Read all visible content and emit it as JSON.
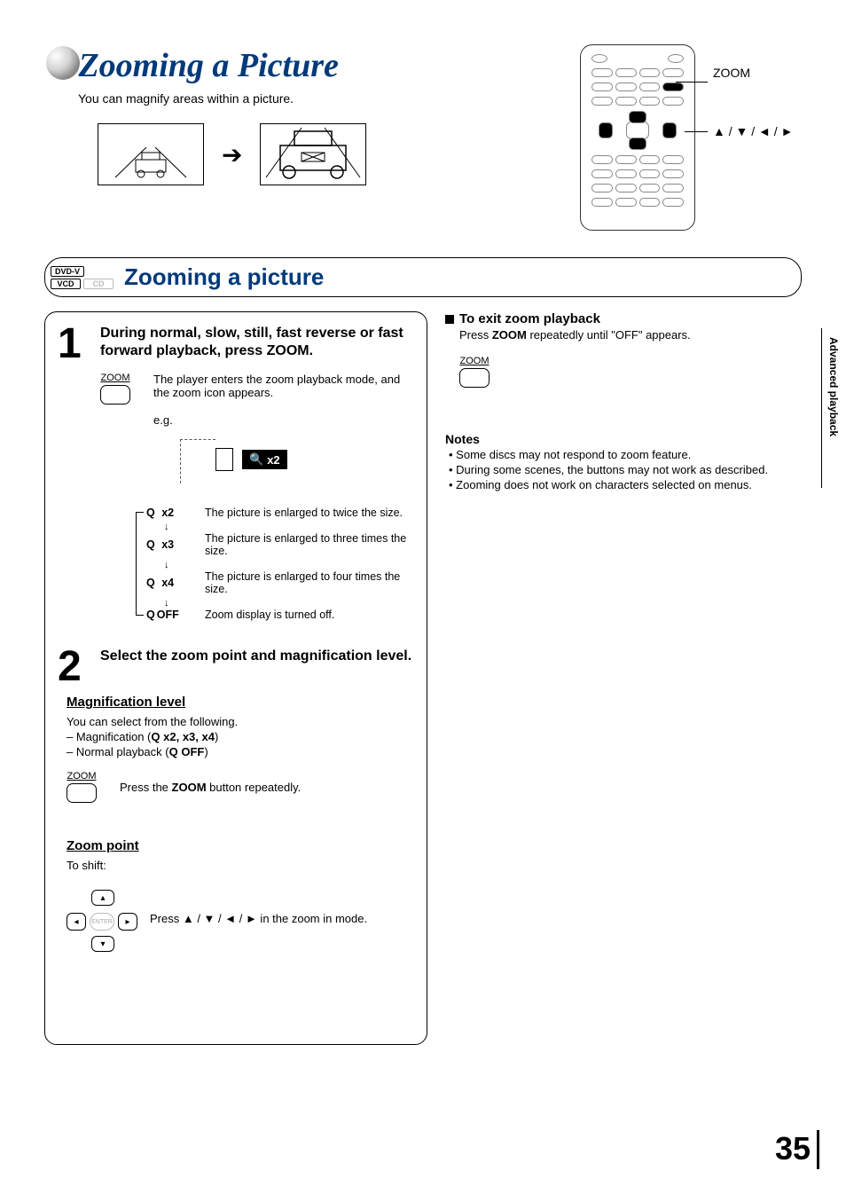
{
  "header": {
    "title": "Zooming a Picture",
    "subtitle": "You can magnify areas within a picture."
  },
  "remote": {
    "label_zoom": "ZOOM",
    "label_dpad": "▲ / ▼ / ◄ / ►"
  },
  "section": {
    "badges": {
      "dvdv": "DVD-V",
      "vcd": "VCD",
      "cd": "CD"
    },
    "title": "Zooming a picture"
  },
  "step1": {
    "num": "1",
    "heading": "During normal, slow, still, fast reverse or fast forward playback, press ZOOM.",
    "button_caption": "ZOOM",
    "desc": "The player enters the zoom playback mode, and the zoom icon appears.",
    "eg": "e.g.",
    "badge": "x2",
    "rows": [
      {
        "label": "x2",
        "desc": "The picture is enlarged to twice the size."
      },
      {
        "label": "x3",
        "desc": "The picture is enlarged to three times the size."
      },
      {
        "label": "x4",
        "desc": "The picture is enlarged to four times the size."
      },
      {
        "label": "OFF",
        "desc": "Zoom display is turned off."
      }
    ]
  },
  "step2": {
    "num": "2",
    "heading": "Select the zoom point and magnification level.",
    "maglevel_h": "Magnification level",
    "maglevel_p": "You can select from the following.",
    "maglevel_l1a": "– Magnification (",
    "maglevel_l1b": "x2, x3, x4",
    "maglevel_l1c": ")",
    "maglevel_l2a": "– Normal playback (",
    "maglevel_l2b": "OFF",
    "maglevel_l2c": ")",
    "btn_caption": "ZOOM",
    "zoom_desc_a": "Press the ",
    "zoom_desc_b": "ZOOM",
    "zoom_desc_c": " button repeatedly.",
    "zoompoint_h": "Zoom point",
    "zoompoint_p": "To shift:",
    "zoompoint_desc": "Press ▲ / ▼ / ◄ / ► in the zoom in mode."
  },
  "right": {
    "exit_h": "To exit zoom playback",
    "exit_p_a": "Press ",
    "exit_p_b": "ZOOM",
    "exit_p_c": " repeatedly until \"OFF\" appears.",
    "btn_caption": "ZOOM",
    "notes_h": "Notes",
    "notes": [
      "Some discs may not respond to zoom feature.",
      "During some scenes, the buttons may not work as described.",
      "Zooming does not work on characters selected on menus."
    ]
  },
  "side_tab": "Advanced playback",
  "page_number": "35"
}
